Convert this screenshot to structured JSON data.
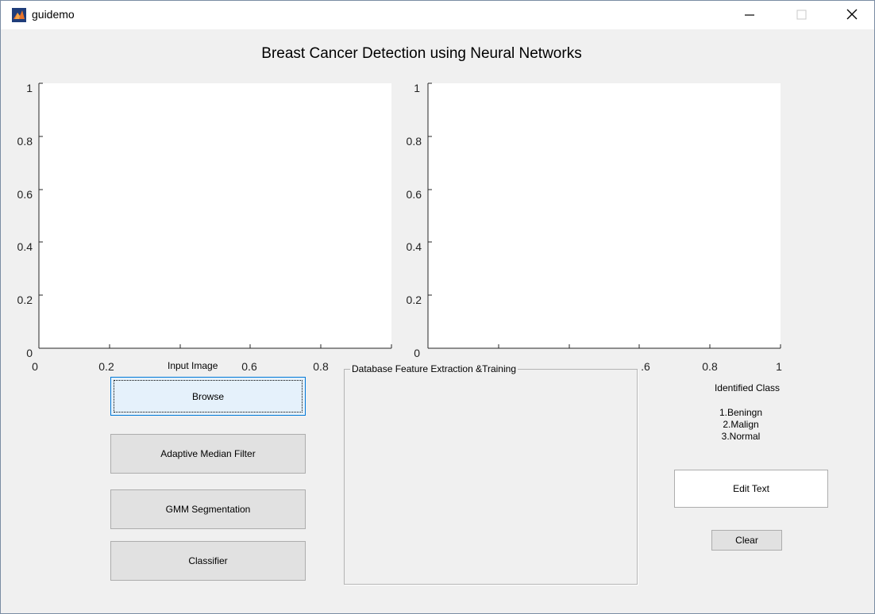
{
  "window": {
    "title": "guidemo"
  },
  "figure_title": "Breast Cancer Detection using Neural Networks",
  "axes_left": {
    "yticks": [
      "0",
      "0.2",
      "0.4",
      "0.6",
      "0.8",
      "1"
    ],
    "xticks": [
      "0",
      "0.2",
      "0.6",
      "0.8"
    ],
    "label": "Input Image"
  },
  "axes_right": {
    "yticks": [
      "0",
      "0.2",
      "0.4",
      "0.6",
      "0.8",
      "1"
    ],
    "xticks": [
      ".6",
      "0.8",
      "1"
    ]
  },
  "buttons": {
    "browse": "Browse",
    "adaptive": "Adaptive Median Filter",
    "gmm": "GMM Segmentation",
    "classifier": "Classifier",
    "clear": "Clear"
  },
  "panel": {
    "title": "Database Feature Extraction &Training"
  },
  "identified_class": {
    "label": "Identified Class",
    "line1": "1.Beningn",
    "line2": "2.Malign",
    "line3": "3.Normal"
  },
  "edit_text": "Edit Text"
}
